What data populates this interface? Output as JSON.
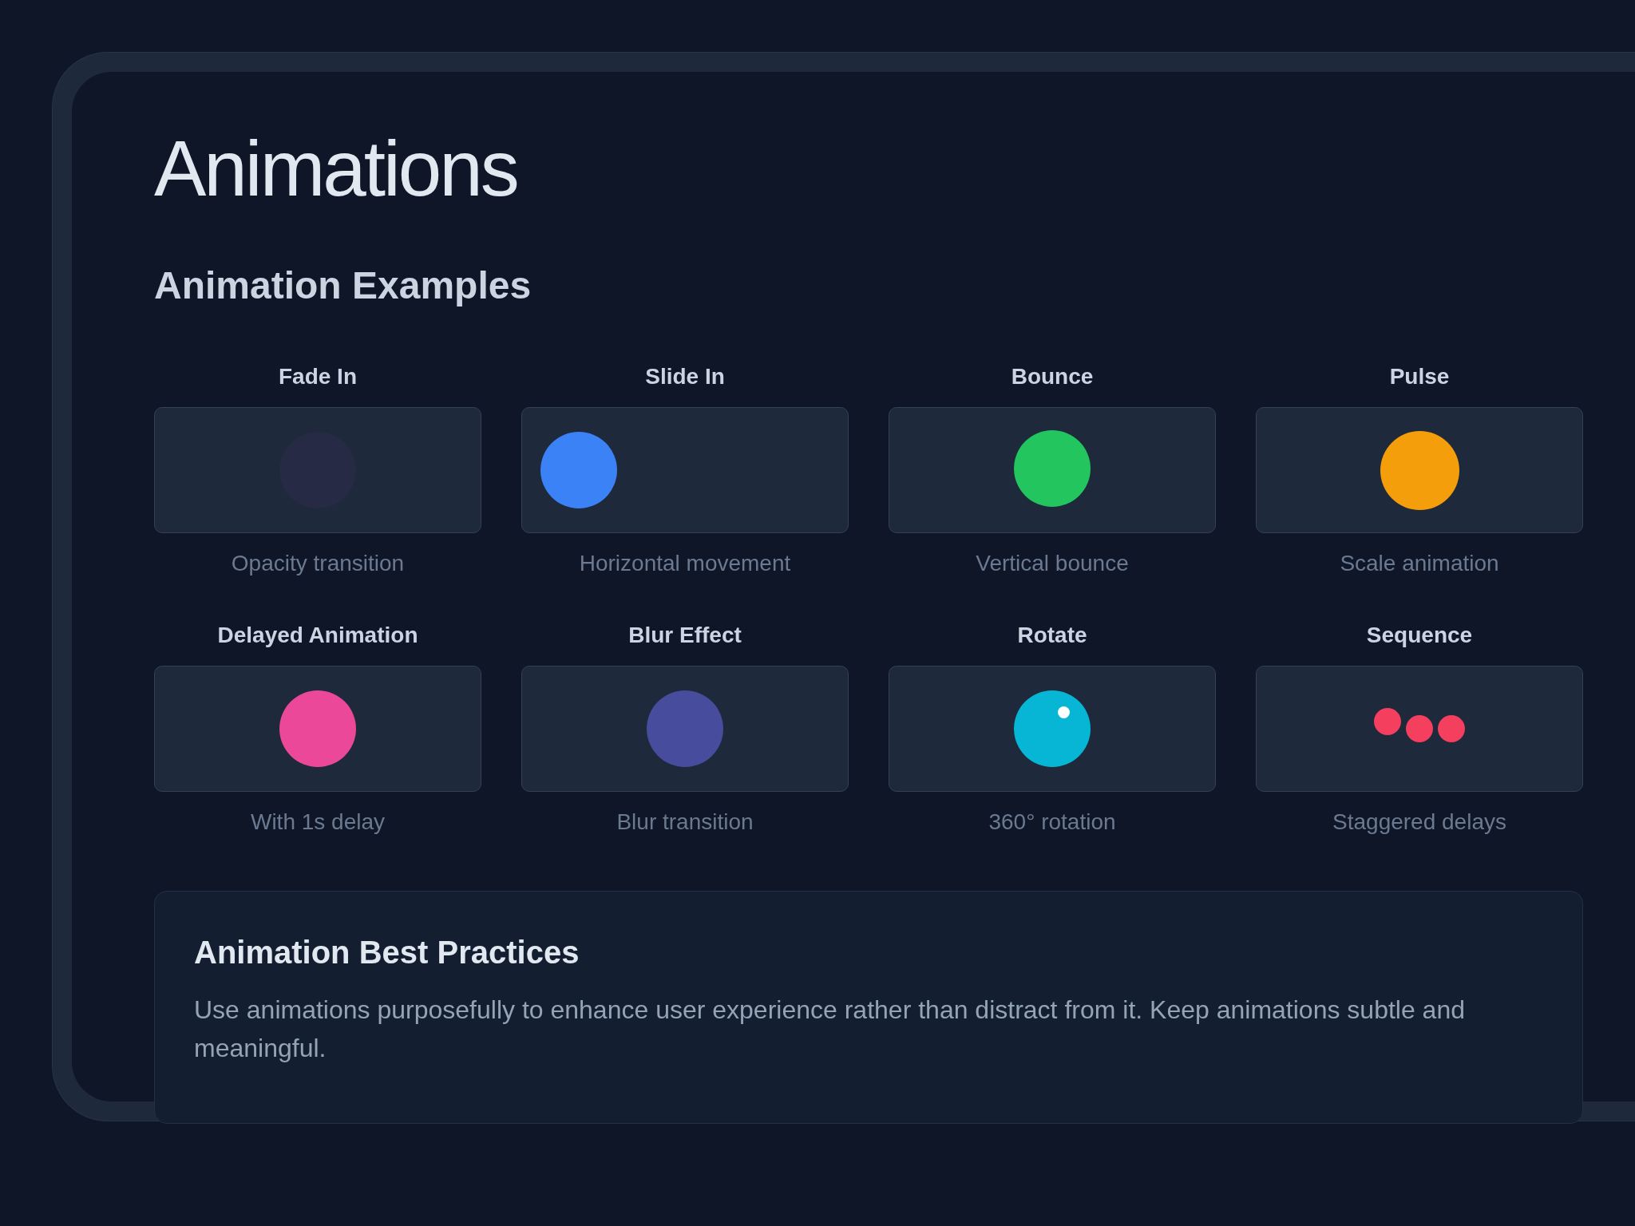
{
  "title": "Animations",
  "section_title": "Animation Examples",
  "examples": [
    {
      "kind": "fade",
      "label": "Fade In",
      "description": "Opacity transition",
      "color": "#272a45"
    },
    {
      "kind": "slide",
      "label": "Slide In",
      "description": "Horizontal movement",
      "color": "#3b82f6"
    },
    {
      "kind": "bounce",
      "label": "Bounce",
      "description": "Vertical bounce",
      "color": "#22c55e"
    },
    {
      "kind": "pulse",
      "label": "Pulse",
      "description": "Scale animation",
      "color": "#f59e0b"
    },
    {
      "kind": "delayed",
      "label": "Delayed Animation",
      "description": "With 1s delay",
      "color": "#ec4899"
    },
    {
      "kind": "blur",
      "label": "Blur Effect",
      "description": "Blur transition",
      "color": "#474c9c"
    },
    {
      "kind": "rotate",
      "label": "Rotate",
      "description": "360° rotation",
      "color": "#06b6d4"
    },
    {
      "kind": "sequence",
      "label": "Sequence",
      "description": "Staggered delays",
      "color": "#f43f5e"
    }
  ],
  "best_practices": {
    "title": "Animation Best Practices",
    "text": "Use animations purposefully to enhance user experience rather than distract from it. Keep animations subtle and meaningful."
  }
}
